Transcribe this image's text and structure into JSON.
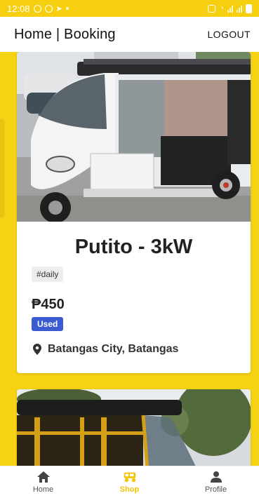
{
  "status_bar": {
    "time": "12:08"
  },
  "app_bar": {
    "title": "Home | Booking",
    "logout_label": "LOGOUT"
  },
  "listings": [
    {
      "title": "Putito - 3kW",
      "tag": "#daily",
      "price": "₱450",
      "condition": "Used",
      "location": "Batangas City, Batangas"
    }
  ],
  "bottom_nav": {
    "items": [
      {
        "label": "Home",
        "icon": "home-icon"
      },
      {
        "label": "Shop",
        "icon": "tricycle-icon"
      },
      {
        "label": "Profile",
        "icon": "person-icon"
      }
    ],
    "active": "Shop"
  },
  "colors": {
    "brand_yellow": "#f5d214",
    "badge_blue": "#3b5bd0",
    "active_nav": "#f2c500"
  }
}
